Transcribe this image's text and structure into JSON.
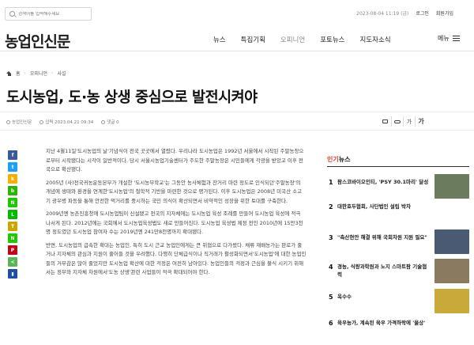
{
  "topbar": {
    "search_placeholder": "검색어를 입력해주세요",
    "date": "2023-08-04 11:19 (금)",
    "login": "로그인",
    "signup": "회원가입"
  },
  "header": {
    "logo": "농업인신문",
    "nav": [
      "뉴스",
      "특집기획",
      "오피니언",
      "포토뉴스",
      "지도자소식"
    ],
    "active_nav": "오피니언",
    "menu_label": "메뉴"
  },
  "breadcrumb": {
    "home": "홈",
    "section": "오피니언",
    "sub": "사설"
  },
  "article": {
    "title": "도시농업, 도·농 상생 중심으로 발전시켜야",
    "author": "농업인신문",
    "published": "입력 2023.04.21 09:34",
    "comments": "댓글 0",
    "font_down": "가",
    "font_up": "가",
    "paragraphs": [
      "지난 4월11일'도시농업의 날'기념식이 전국 곳곳에서 열렸다. 우리나라 도시농업은 1992년 서울에서 시작된 주말농장으로부터 시작됐다는 시각이 일반적이다. 당시 서울시농업기술센터가 주도한 주말농장은 시민들에게 각광을 받았고 이후 전국으로 확산됐다.",
      "2005년 (사)전국귀농운동본부가 개설한 '도시농부학교'는 그동안 농사체험과 잔거리 마련 정도로 인식되던'주말농장'의 개념에 생태와 환경을 연계한'도시농업'의 철학적 기반을 마련한 것으로 평가된다. 이후 도시농업은 2008년 미국산 소고기 광우병 파동을 통해 안전한 먹거리를 중시하는 국민 의식이 확산되면서 비약적인 성장을 위한 토대를 구축한다.",
      "2009년엔 농촌진흥청에 도시농업팀이 신설됐고 전국의 지자체에는 도시농업 육성 조례를 만들어 도시농업 육성에 적극 나서게 된다. 2012년에는 국회에서 도시농업육성법도 새로 만들어진다. 도시농업 육성법 제정 전인 2010년에 15만3천명 정도였던 도시농업 참여자 수는 2019년엔 241만8천명까지 확대됐다.",
      "반면, 도시농업의 급속한 확대는 농업인, 특히 도시 근교 농업인에게는 큰 위협으로 다가왔다. 채류 재배농가는 판로가 줄거나 지자체의 관심과 지원이 줄어들 것을 우려했다. 다행히 단체급식이나 직거래가 활성화되면서'도시농업'에 대한 농업인들의 거부감은 많이 줄었지만 도시농업 확산에 대한 걱정은 여전히 남아있다. 농업인들의 걱정과 근심을 불식 시키기 위해서는 정부와 지자체 차원에서'도농 상생'관련 사업들이 적극 확대되어야 한다."
    ]
  },
  "share_icons": [
    {
      "name": "facebook-icon",
      "glyph": "f",
      "color": "#3b5998"
    },
    {
      "name": "twitter-icon",
      "glyph": "t",
      "color": "#1da1f2"
    },
    {
      "name": "kakaostory-icon",
      "glyph": "k",
      "color": "#f3b000"
    },
    {
      "name": "naver-band-icon",
      "glyph": "b",
      "color": "#2db400"
    },
    {
      "name": "naver-blog-icon",
      "glyph": "N",
      "color": "#1ec800"
    },
    {
      "name": "line-icon",
      "glyph": "L",
      "color": "#00b900"
    },
    {
      "name": "kakaotalk-icon",
      "glyph": "T",
      "color": "#c9a600"
    },
    {
      "name": "naver-icon",
      "glyph": "N",
      "color": "#1ec800"
    },
    {
      "name": "pinterest-icon",
      "glyph": "P",
      "color": "#bd081c"
    },
    {
      "name": "share-icon",
      "glyph": "<",
      "color": "#59b55a"
    },
    {
      "name": "bookmark-icon",
      "glyph": "▮",
      "color": "#1e4fa3"
    }
  ],
  "popular": {
    "title_accent": "인기",
    "title_rest": "뉴스",
    "items": [
      {
        "rank": "1",
        "text": "팜스코바이오인티, 'PSY 30.1마리' 달성",
        "thumb_color": "#6b7b5e"
      },
      {
        "rank": "2",
        "text": "대한호두협회, 사단법인 설립 박차",
        "thumb_color": ""
      },
      {
        "rank": "3",
        "text": "\"축산현안 해결 위해 국회차원 지원 필요\"",
        "thumb_color": "#4a5a72"
      },
      {
        "rank": "4",
        "text": "경농, 식량과학원과 노지 스마트팜 기술협력",
        "thumb_color": "#8a7a60"
      },
      {
        "rank": "5",
        "text": "옥수수",
        "thumb_color": "#c8a93a"
      },
      {
        "rank": "6",
        "text": "육우농가, 계속된 육우 가격하락에 '울상'",
        "thumb_color": ""
      }
    ]
  }
}
